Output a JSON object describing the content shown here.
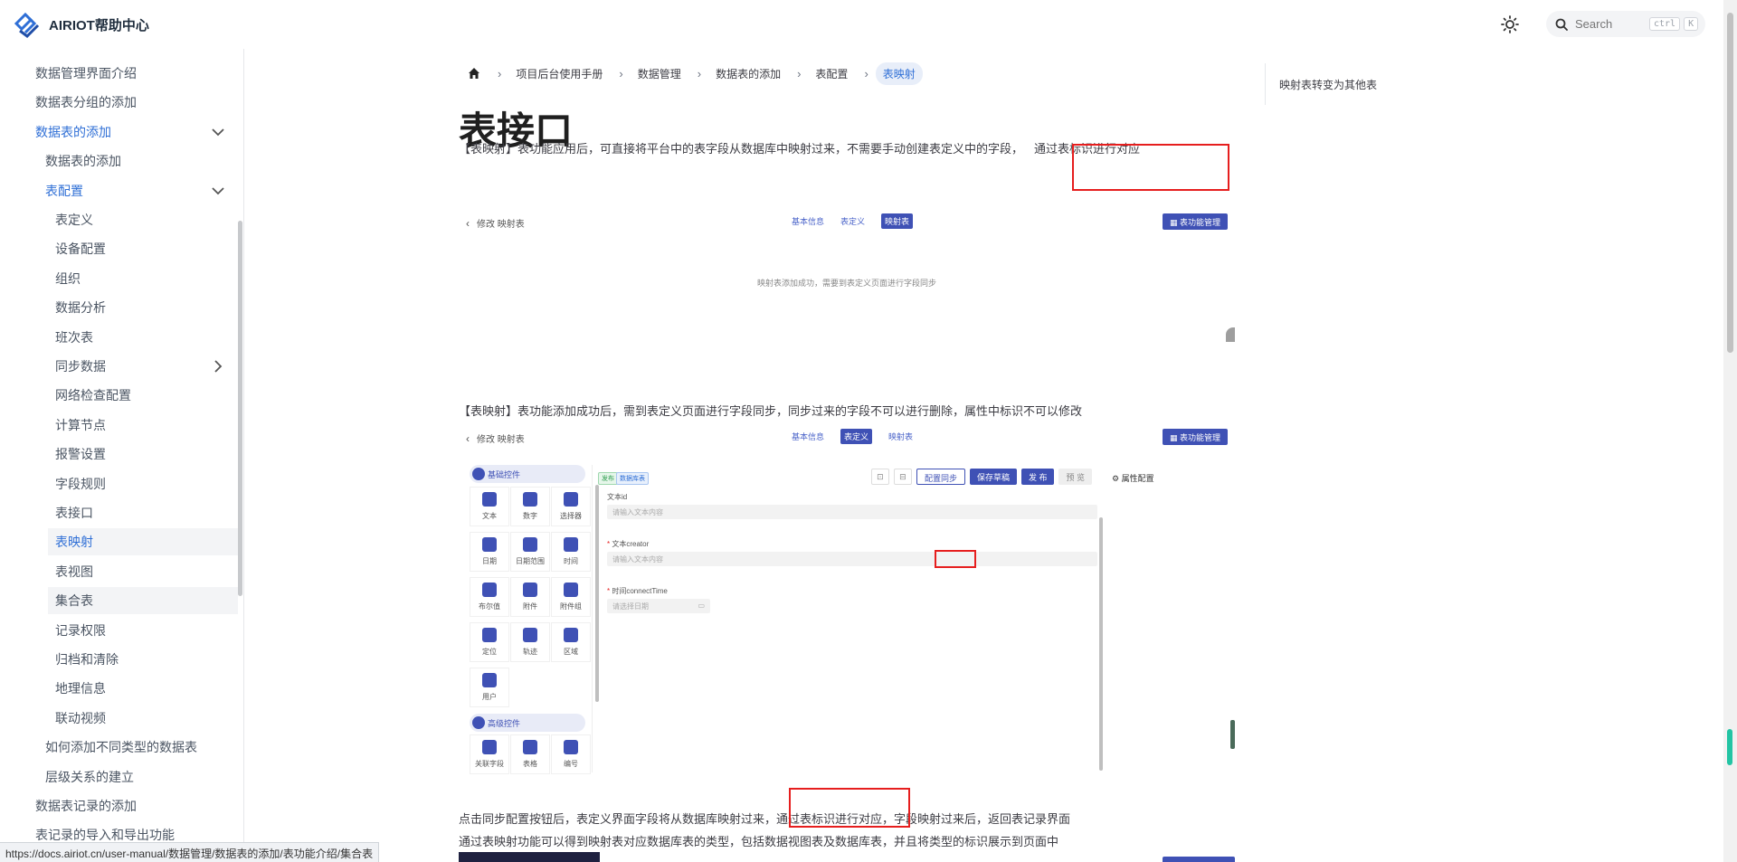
{
  "header": {
    "logo_text": "AIRIOT帮助中心",
    "search_placeholder": "Search",
    "kbd_ctrl": "ctrl",
    "kbd_k": "K"
  },
  "sidebar": {
    "items": [
      {
        "label": "数据管理界面介绍",
        "level": 0
      },
      {
        "label": "数据表分组的添加",
        "level": 0
      },
      {
        "label": "数据表的添加",
        "level": 0,
        "active": true,
        "chevron": "down"
      },
      {
        "label": "数据表的添加",
        "level": 1
      },
      {
        "label": "表配置",
        "level": 1,
        "active": true,
        "chevron": "down"
      },
      {
        "label": "表定义",
        "level": 2
      },
      {
        "label": "设备配置",
        "level": 2
      },
      {
        "label": "组织",
        "level": 2
      },
      {
        "label": "数据分析",
        "level": 2
      },
      {
        "label": "班次表",
        "level": 2
      },
      {
        "label": "同步数据",
        "level": 2,
        "chevron": "right"
      },
      {
        "label": "网络检查配置",
        "level": 2
      },
      {
        "label": "计算节点",
        "level": 2
      },
      {
        "label": "报警设置",
        "level": 2
      },
      {
        "label": "字段规则",
        "level": 2
      },
      {
        "label": "表接口",
        "level": 2
      },
      {
        "label": "表映射",
        "level": 2,
        "active": true,
        "selected": true
      },
      {
        "label": "表视图",
        "level": 2
      },
      {
        "label": "集合表",
        "level": 2,
        "selected": true
      },
      {
        "label": "记录权限",
        "level": 2
      },
      {
        "label": "归档和清除",
        "level": 2
      },
      {
        "label": "地理信息",
        "level": 2
      },
      {
        "label": "联动视频",
        "level": 2
      },
      {
        "label": "如何添加不同类型的数据表",
        "level": 1
      },
      {
        "label": "层级关系的建立",
        "level": 1
      },
      {
        "label": "数据表记录的添加",
        "level": 0
      },
      {
        "label": "表记录的导入和导出功能",
        "level": 0
      }
    ]
  },
  "breadcrumb": [
    "项目后台使用手册",
    "数据管理",
    "数据表的添加",
    "表配置",
    "表映射"
  ],
  "page": {
    "title": "表接口",
    "para1": "【表映射】表功能应用后，可直接将平台中的表字段从数据库中映射过来，不需要手动创建表定义中的字段，",
    "para1_boxed": "通过表标识进行对应",
    "para2": "【表映射】表功能添加成功后，需到表定义页面进行字段同步，同步过来的字段不可以进行删除，属性中标识不可以修改",
    "para3_a": "点击同步配置按钮后，表定义界面字段将从数据库映射过来，",
    "para3_boxed": "通过表标识进行对应，",
    "para3_b": "字段映射过来后，返回表记录界面",
    "para4": "通过表映射功能可以得到映射表对应数据库表的类型，包括数据视图表及数据库表，并且将类型的标识展示到页面中"
  },
  "figure1": {
    "back_label": "修改 映射表",
    "tabs": [
      "基本信息",
      "表定义",
      "映射表"
    ],
    "active_tab": 2,
    "action_label": "表功能管理",
    "empty_text": "映射表添加成功，需要到表定义页面进行字段同步"
  },
  "figure2": {
    "back_label": "修改 映射表",
    "tabs": [
      "基本信息",
      "表定义",
      "映射表"
    ],
    "active_tab": 1,
    "action_label": "表功能管理",
    "group_basic": "基础控件",
    "group_advanced": "高级控件",
    "basic_controls": [
      "文本",
      "数字",
      "选择器",
      "日期",
      "日期范围",
      "时间",
      "布尔值",
      "附件",
      "附件组",
      "定位",
      "轨迹",
      "区域",
      "用户"
    ],
    "advanced_controls": [
      "关联字段",
      "表格",
      "编号"
    ],
    "tags": [
      "发布",
      "数据库表"
    ],
    "toolbar": {
      "sync": "配置同步",
      "save_draft": "保存草稿",
      "publish": "发 布",
      "preview": "预 览",
      "props": "属性配置"
    },
    "fields": [
      {
        "label": "文本id",
        "placeholder": "请输入文本内容",
        "required": false
      },
      {
        "label": "文本creator",
        "placeholder": "请输入文本内容",
        "required": true
      },
      {
        "label": "时间connectTime",
        "placeholder": "请选择日期",
        "required": true
      }
    ]
  },
  "toc": {
    "item": "映射表转变为其他表"
  },
  "status_url": "https://docs.airiot.cn/user-manual/数据管理/数据表的添加/表功能介绍/集合表",
  "colors": {
    "accent": "#2f6fd6",
    "brand_blue": "#3f51b5",
    "highlight_red": "#e61e1e"
  }
}
